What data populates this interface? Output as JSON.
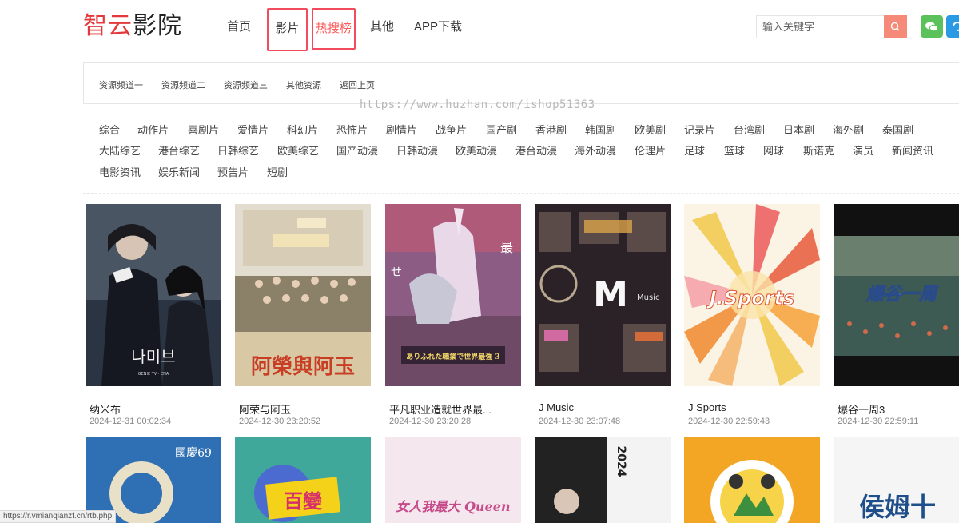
{
  "logo": {
    "part1": "智云",
    "part2": "影院"
  },
  "nav": [
    {
      "label": "首页"
    },
    {
      "label": "影片"
    },
    {
      "label": "热搜榜"
    },
    {
      "label": "其他"
    },
    {
      "label": "APP下载"
    }
  ],
  "search": {
    "placeholder": "输入关键字"
  },
  "channels": [
    "资源频道一",
    "资源频道二",
    "资源频道三",
    "其他资源",
    "返回上页"
  ],
  "watermark": "https://www.huzhan.com/ishop51363",
  "categories": [
    "综合",
    "动作片",
    "喜剧片",
    "爱情片",
    "科幻片",
    "恐怖片",
    "剧情片",
    "战争片",
    "国产剧",
    "香港剧",
    "韩国剧",
    "欧美剧",
    "记录片",
    "台湾剧",
    "日本剧",
    "海外剧",
    "泰国剧",
    "大陆综艺",
    "港台综艺",
    "日韩综艺",
    "欧美综艺",
    "国产动漫",
    "日韩动漫",
    "欧美动漫",
    "港台动漫",
    "海外动漫",
    "伦理片",
    "足球",
    "篮球",
    "网球",
    "斯诺克",
    "演员",
    "新闻资讯",
    "电影资讯",
    "娱乐新闻",
    "预告片",
    "短剧"
  ],
  "movies": [
    {
      "title": "纳米布",
      "date": "2024-12-31 00:02:34",
      "poster_text": "나미브",
      "bg": "#2b3442"
    },
    {
      "title": "阿荣与阿玉",
      "date": "2024-12-30 23:20:52",
      "poster_text": "阿榮與阿玉",
      "bg": "#c9b48a"
    },
    {
      "title": "平凡职业造就世界最...",
      "date": "2024-12-30 23:20:28",
      "poster_text": "ありふれた職業で世界最強 3",
      "bg": "#6e4a66"
    },
    {
      "title": "J Music",
      "date": "2024-12-30 23:07:48",
      "poster_text": "Music",
      "bg": "#3a2a2a"
    },
    {
      "title": "J Sports",
      "date": "2024-12-30 22:59:43",
      "poster_text": "J.Sports",
      "bg": "#f4d9a4"
    },
    {
      "title": "爆谷一周3",
      "date": "2024-12-30 22:59:11",
      "poster_text": "爆谷一周",
      "bg": "#2a3a36"
    }
  ],
  "row2": [
    {
      "poster_text": "國慶69",
      "bg": "#2f6fb3"
    },
    {
      "poster_text": "百變",
      "bg": "#3fa89a"
    },
    {
      "poster_text": "女人我最大 Queen",
      "bg": "#f5e7ee"
    },
    {
      "poster_text": "2024",
      "bg": "#222222"
    },
    {
      "poster_text": "",
      "bg": "#f2a623"
    },
    {
      "poster_text": "侯姆十",
      "bg": "#f5f5f5"
    }
  ],
  "status_url": "https://r.vmianqianzf.cn/rtb.php",
  "colors": {
    "accent": "#e4393c",
    "hot": "#ff5c5c",
    "search_button": "#f58a78",
    "wechat": "#5ac15b",
    "highlight_box": "#f24b5f"
  },
  "icons": {
    "search": "search-icon",
    "wechat": "wechat-icon",
    "refresh": "refresh-icon"
  }
}
